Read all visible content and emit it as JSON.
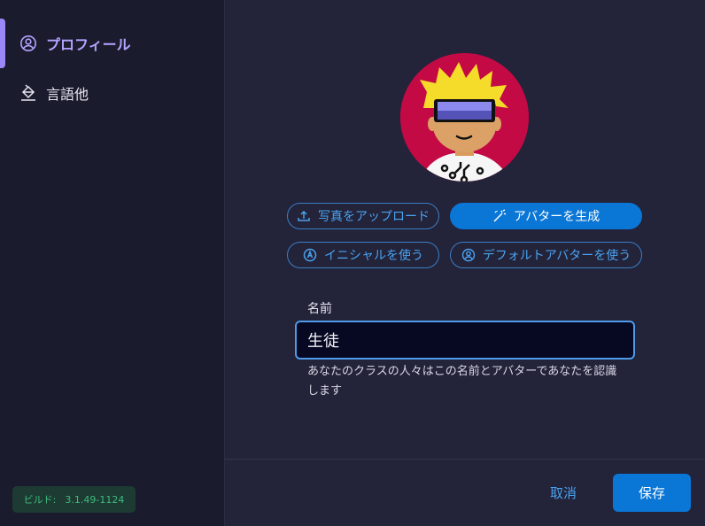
{
  "sidebar": {
    "items": [
      {
        "label": "プロフィール",
        "icon": "user-circle-icon",
        "active": true
      },
      {
        "label": "言語他",
        "icon": "paint-bucket-icon",
        "active": false
      }
    ],
    "build": {
      "label": "ビルド:",
      "version": "3.1.49-1124"
    }
  },
  "profile": {
    "avatar_icon": "avatar-sunglasses-illustration",
    "buttons": {
      "upload": "写真をアップロード",
      "generate": "アバターを生成",
      "initials": "イニシャルを使う",
      "default_avatar": "デフォルトアバターを使う"
    },
    "name_label": "名前",
    "name_value": "生徒",
    "hint": "あなたのクラスの人々はこの名前とアバターであなたを認識します"
  },
  "footer": {
    "cancel": "取消",
    "save": "保存"
  },
  "colors": {
    "accent_purple": "#9b87f5",
    "primary_blue": "#0a76d6",
    "link_blue": "#4aa3f0",
    "avatar_bg": "#c40a45",
    "build_green": "#3dbb7f"
  }
}
